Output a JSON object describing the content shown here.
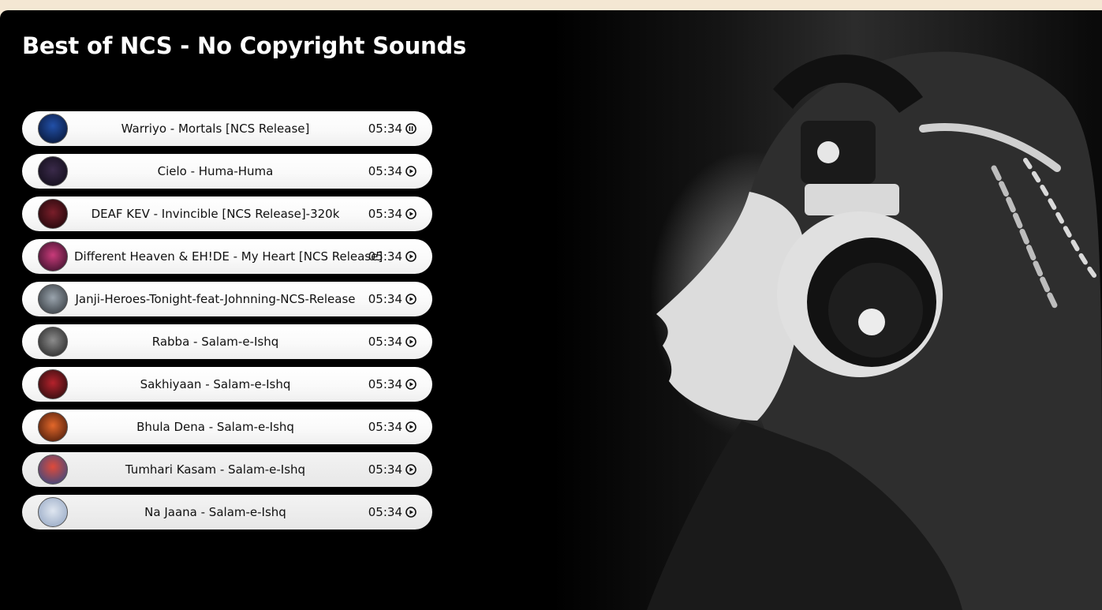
{
  "page": {
    "title": "Best of NCS - No Copyright Sounds"
  },
  "colors": {
    "page_background": "#f4e7d3",
    "panel_background": "#000000",
    "track_background": "#ffffff",
    "text": "#111111",
    "title_text": "#ffffff"
  },
  "tracks": [
    {
      "name": "Warriyo - Mortals [NCS Release]",
      "duration": "05:34",
      "state_icon": "pause-icon",
      "thumb_colors": [
        "#2250a8",
        "#05102b"
      ]
    },
    {
      "name": "Cielo - Huma-Huma",
      "duration": "05:34",
      "state_icon": "play-icon",
      "thumb_colors": [
        "#3a2a4a",
        "#0d0a14"
      ]
    },
    {
      "name": "DEAF KEV - Invincible [NCS Release]-320k",
      "duration": "05:34",
      "state_icon": "play-icon",
      "thumb_colors": [
        "#7a1e2a",
        "#140406"
      ]
    },
    {
      "name": "Different Heaven & EH!DE - My Heart [NCS Release]",
      "duration": "05:34",
      "state_icon": "play-icon",
      "thumb_colors": [
        "#c93b7a",
        "#2a0c22"
      ]
    },
    {
      "name": "Janji-Heroes-Tonight-feat-Johnning-NCS-Release",
      "duration": "05:34",
      "state_icon": "play-icon",
      "thumb_colors": [
        "#9aa4ad",
        "#2c3136"
      ]
    },
    {
      "name": "Rabba - Salam-e-Ishq",
      "duration": "05:34",
      "state_icon": "play-icon",
      "thumb_colors": [
        "#8c8c8c",
        "#1e1e1e"
      ]
    },
    {
      "name": "Sakhiyaan - Salam-e-Ishq",
      "duration": "05:34",
      "state_icon": "play-icon",
      "thumb_colors": [
        "#b5222c",
        "#1a0a0a"
      ]
    },
    {
      "name": "Bhula Dena - Salam-e-Ishq",
      "duration": "05:34",
      "state_icon": "play-icon",
      "thumb_colors": [
        "#e3672a",
        "#3a1408"
      ]
    },
    {
      "name": "Tumhari Kasam - Salam-e-Ishq",
      "duration": "05:34",
      "state_icon": "play-icon",
      "thumb_colors": [
        "#e04a3a",
        "#254a8a"
      ]
    },
    {
      "name": "Na Jaana - Salam-e-Ishq",
      "duration": "05:34",
      "state_icon": "play-icon",
      "thumb_colors": [
        "#dfe6f0",
        "#8fa2c0"
      ]
    }
  ],
  "background_image": "woman-with-headphones-photo"
}
